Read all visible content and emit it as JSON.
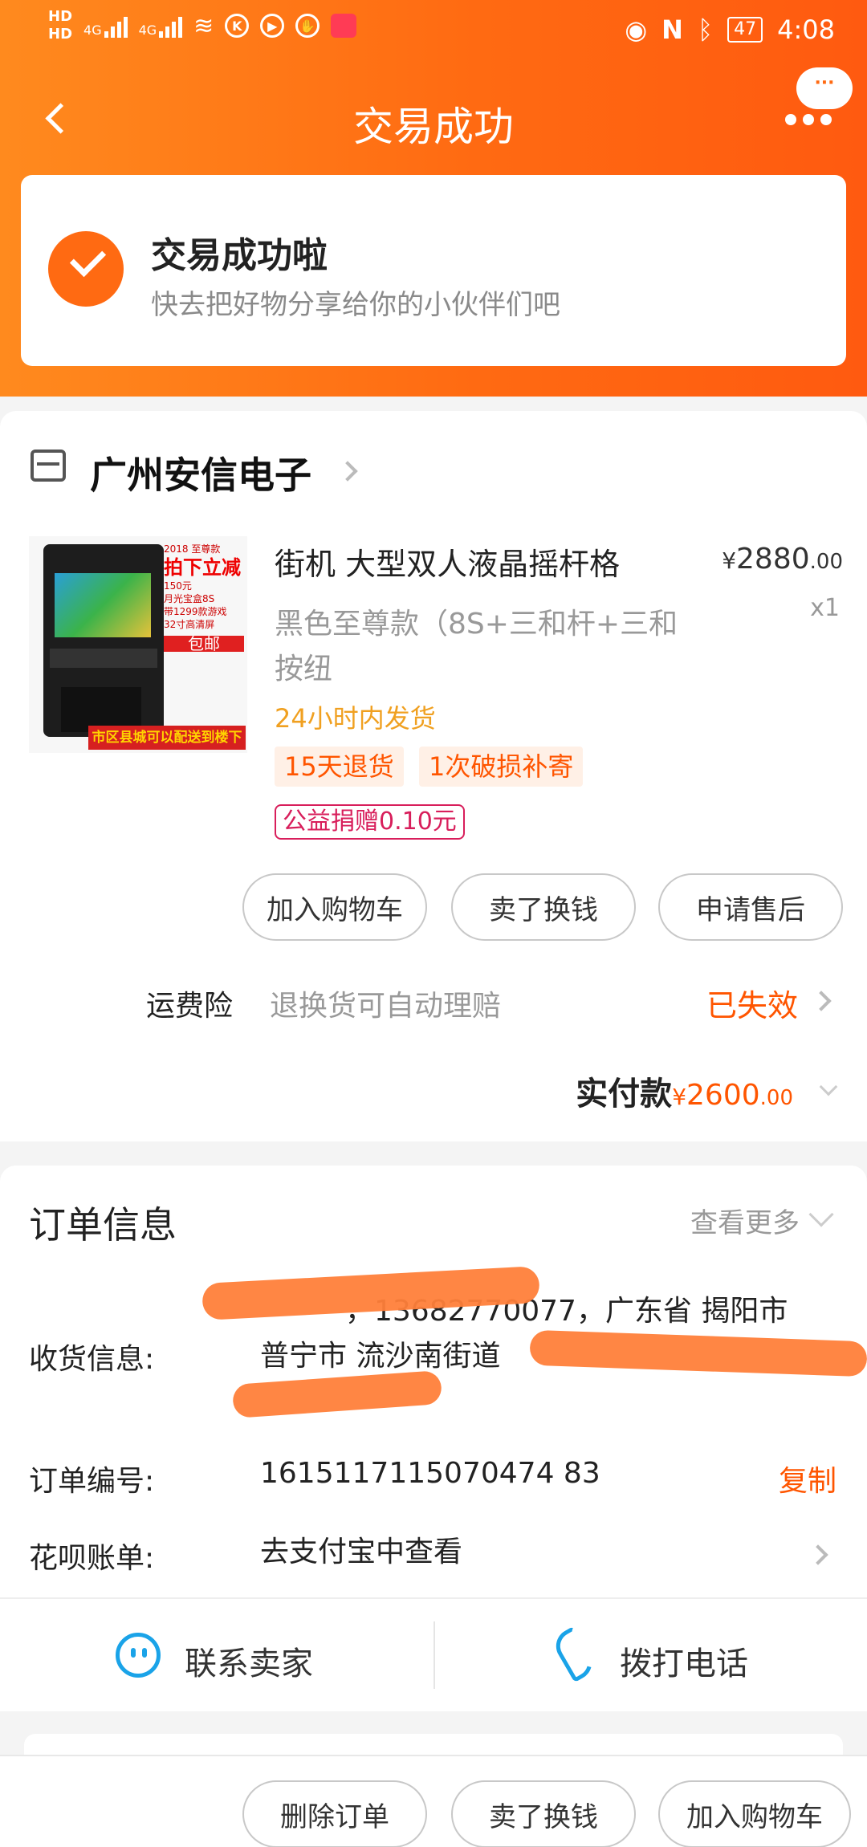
{
  "status_bar": {
    "hd1": "HD",
    "hd2": "HD",
    "net1": "4G",
    "net2": "4G",
    "battery": "47",
    "time": "4:08",
    "icons": [
      "wifi-icon",
      "k-icon",
      "play-icon",
      "hand-icon",
      "huawei-icon",
      "eye-icon",
      "nfc-icon",
      "bluetooth-icon",
      "battery-icon"
    ]
  },
  "nav": {
    "title": "交易成功",
    "more_bubble": "···"
  },
  "success": {
    "title": "交易成功啦",
    "subtitle": "快去把好物分享给你的小伙伴们吧"
  },
  "shop": {
    "name": "广州安信电子"
  },
  "product": {
    "image_promo": {
      "year": "2018 至尊款",
      "headline": "拍下立减",
      "sub": "150元",
      "l1": "月光宝盒8S",
      "l2": "带1299款游戏",
      "l3": "32寸高清屏",
      "badge": "包邮",
      "banner": "市区县城可以配送到楼下"
    },
    "name": "街机 大型双人液晶摇杆格",
    "price_symbol": "¥",
    "price_int": "2880",
    "price_dec": ".00",
    "spec": "黑色至尊款（8S+三和杆+三和按纽",
    "qty": "x1",
    "shipping": "24小时内发货",
    "tags": [
      "15天退货",
      "1次破损补寄"
    ],
    "charity": "公益捐赠0.10元"
  },
  "actions": {
    "add_cart": "加入购物车",
    "sell": "卖了换钱",
    "after_sale": "申请售后"
  },
  "insurance": {
    "label": "运费险",
    "desc": "退换货可自动理赔",
    "status": "已失效"
  },
  "paid": {
    "label": "实付款",
    "symbol": "¥",
    "amount": "2600",
    "decimal": ".00"
  },
  "order_info": {
    "title": "订单信息",
    "more": "查看更多",
    "address_label": "收货信息:",
    "address_line1": "，13682770077，广东省 揭阳市",
    "address_line2": "普宁市 流沙南街道",
    "order_no_label": "订单编号:",
    "order_no": "1615117115070474 83",
    "copy": "复制",
    "huabei_label": "花呗账单:",
    "huabei_value": "去支付宝中查看"
  },
  "contact": {
    "seller": "联系卖家",
    "call": "拨打电话"
  },
  "bottom": {
    "delete": "删除订单",
    "sell": "卖了换钱",
    "add_cart": "加入购物车"
  },
  "colors": {
    "accent": "#ff6a12",
    "price": "#ff5500",
    "ship": "#f0a020",
    "charity": "#d81e5b",
    "icon_blue": "#1aa3e8"
  }
}
